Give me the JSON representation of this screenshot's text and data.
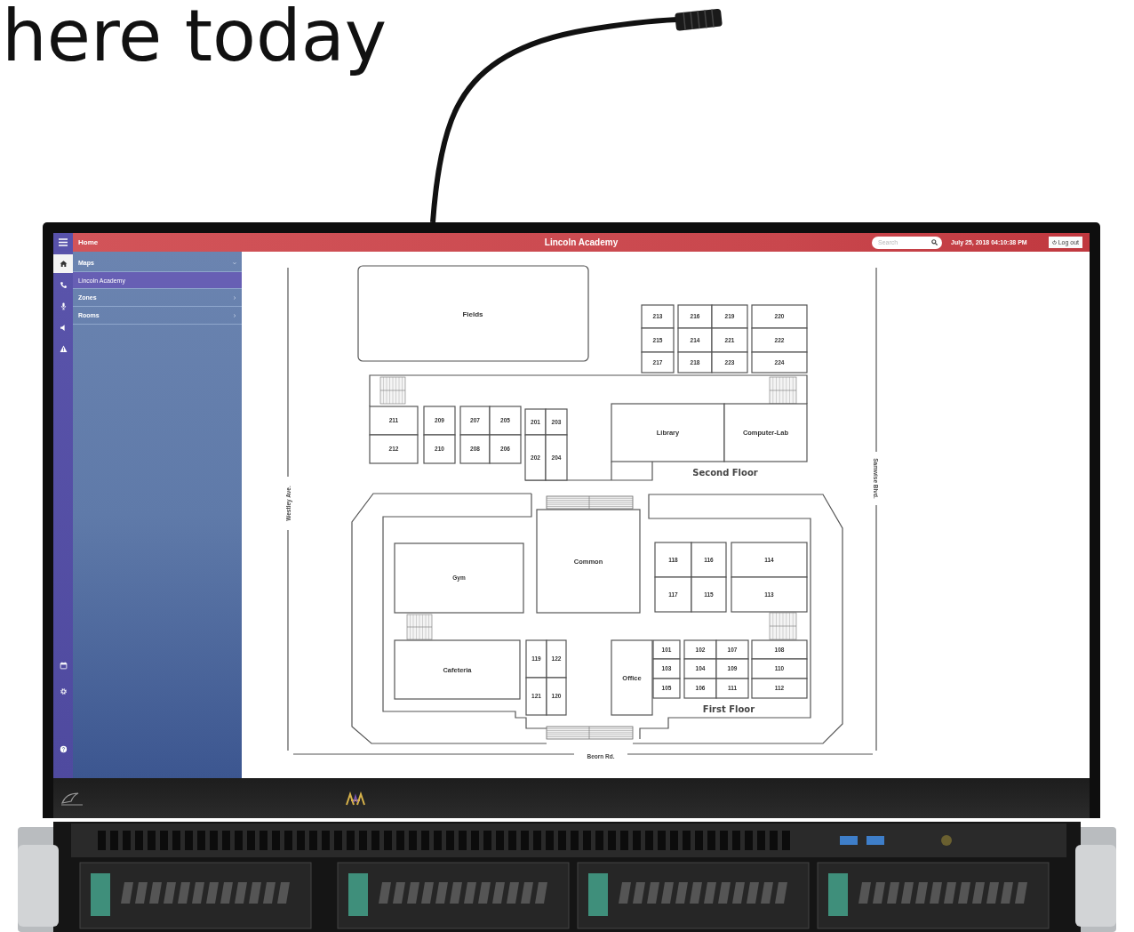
{
  "headline": "here today",
  "topbar": {
    "home": "Home",
    "title": "Lincoln Academy",
    "search": {
      "placeholder": "Search"
    },
    "datetime": "July 25, 2018 04:10:38 PM",
    "logout": "Log out"
  },
  "rail": {
    "top": [
      {
        "selected": true
      },
      {
        "selected": false
      },
      {
        "selected": false
      },
      {
        "selected": false
      },
      {
        "selected": false
      }
    ],
    "bottom": [
      {
        "selected": false
      },
      {
        "selected": false
      },
      {
        "selected": false
      }
    ]
  },
  "sidebar": {
    "items": [
      {
        "label": "Maps",
        "expanded": true,
        "children": [
          {
            "label": "Lincoln Academy",
            "selected": true
          }
        ]
      },
      {
        "label": "Zones",
        "expanded": false
      },
      {
        "label": "Rooms",
        "expanded": false
      }
    ]
  },
  "map": {
    "fields": "Fields",
    "floors": [
      {
        "label": "Second Floor",
        "rooms": [
          "213",
          "216",
          "219",
          "220",
          "215",
          "214",
          "221",
          "222",
          "217",
          "218",
          "223",
          "224",
          "211",
          "209",
          "207",
          "205",
          "201",
          "203",
          "212",
          "210",
          "208",
          "206",
          "202",
          "204",
          "Library",
          "Computer-Lab"
        ]
      },
      {
        "label": "First Floor",
        "rooms": [
          "Common",
          "Gym",
          "118",
          "116",
          "114",
          "117",
          "115",
          "113",
          "Cafeteria",
          "119",
          "122",
          "Office",
          "101",
          "102",
          "107",
          "108",
          "103",
          "104",
          "109",
          "110",
          "121",
          "120",
          "105",
          "106",
          "111",
          "112"
        ]
      }
    ],
    "streets": [
      "Westley Ave.",
      "Beorn Rd.",
      "Samwise Blvd."
    ]
  }
}
